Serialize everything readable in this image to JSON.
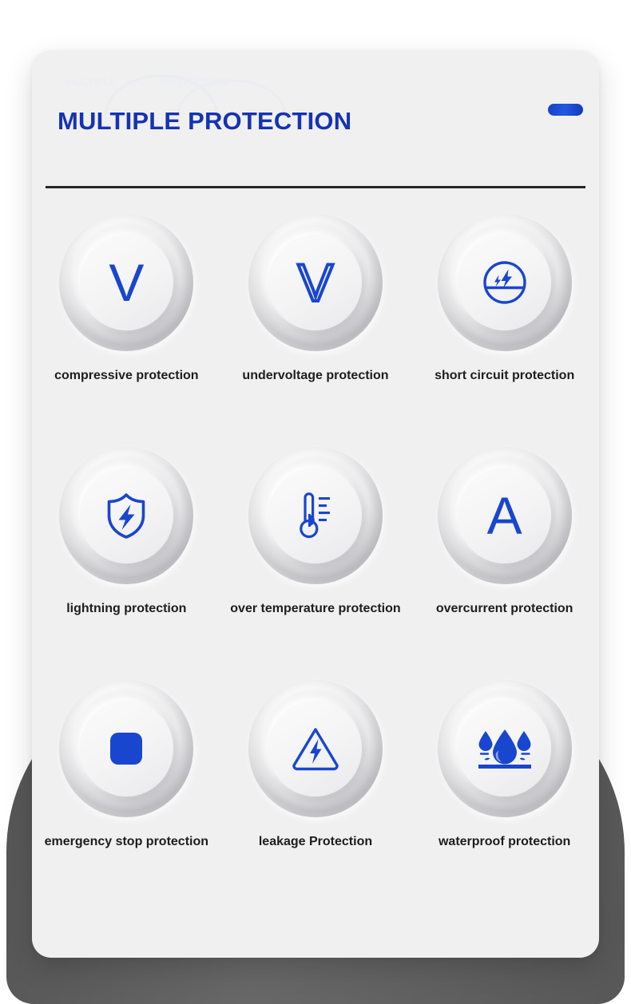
{
  "page": {
    "background_color": "#ffffff",
    "card_color": "#f0f0f1",
    "accent_color": "#1946cf",
    "title_color": "#1533b4",
    "divider_color": "#262626",
    "arch_color": "#5e5e5e"
  },
  "header": {
    "title": "MULTIPLE PROTECTION",
    "watermark_text": "MULTIPLE PROTECTION",
    "indicator_label": ""
  },
  "grid": {
    "items": [
      {
        "icon": "letter-v-solid-icon",
        "glyph": "V",
        "label": "compressive protection"
      },
      {
        "icon": "letter-v-outline-icon",
        "glyph": "V",
        "label": "undervoltage protection"
      },
      {
        "icon": "short-circuit-icon",
        "glyph": "",
        "label": "short circuit protection"
      },
      {
        "icon": "shield-lightning-icon",
        "glyph": "",
        "label": "lightning protection"
      },
      {
        "icon": "thermometer-icon",
        "glyph": "",
        "label": "over temperature protection"
      },
      {
        "icon": "letter-a-solid-icon",
        "glyph": "A",
        "label": "overcurrent protection"
      },
      {
        "icon": "stop-square-icon",
        "glyph": "",
        "label": "emergency stop protection"
      },
      {
        "icon": "warning-triangle-bolt-icon",
        "glyph": "",
        "label": "leakage Protection"
      },
      {
        "icon": "water-droplets-icon",
        "glyph": "",
        "label": "waterproof protection"
      }
    ]
  }
}
